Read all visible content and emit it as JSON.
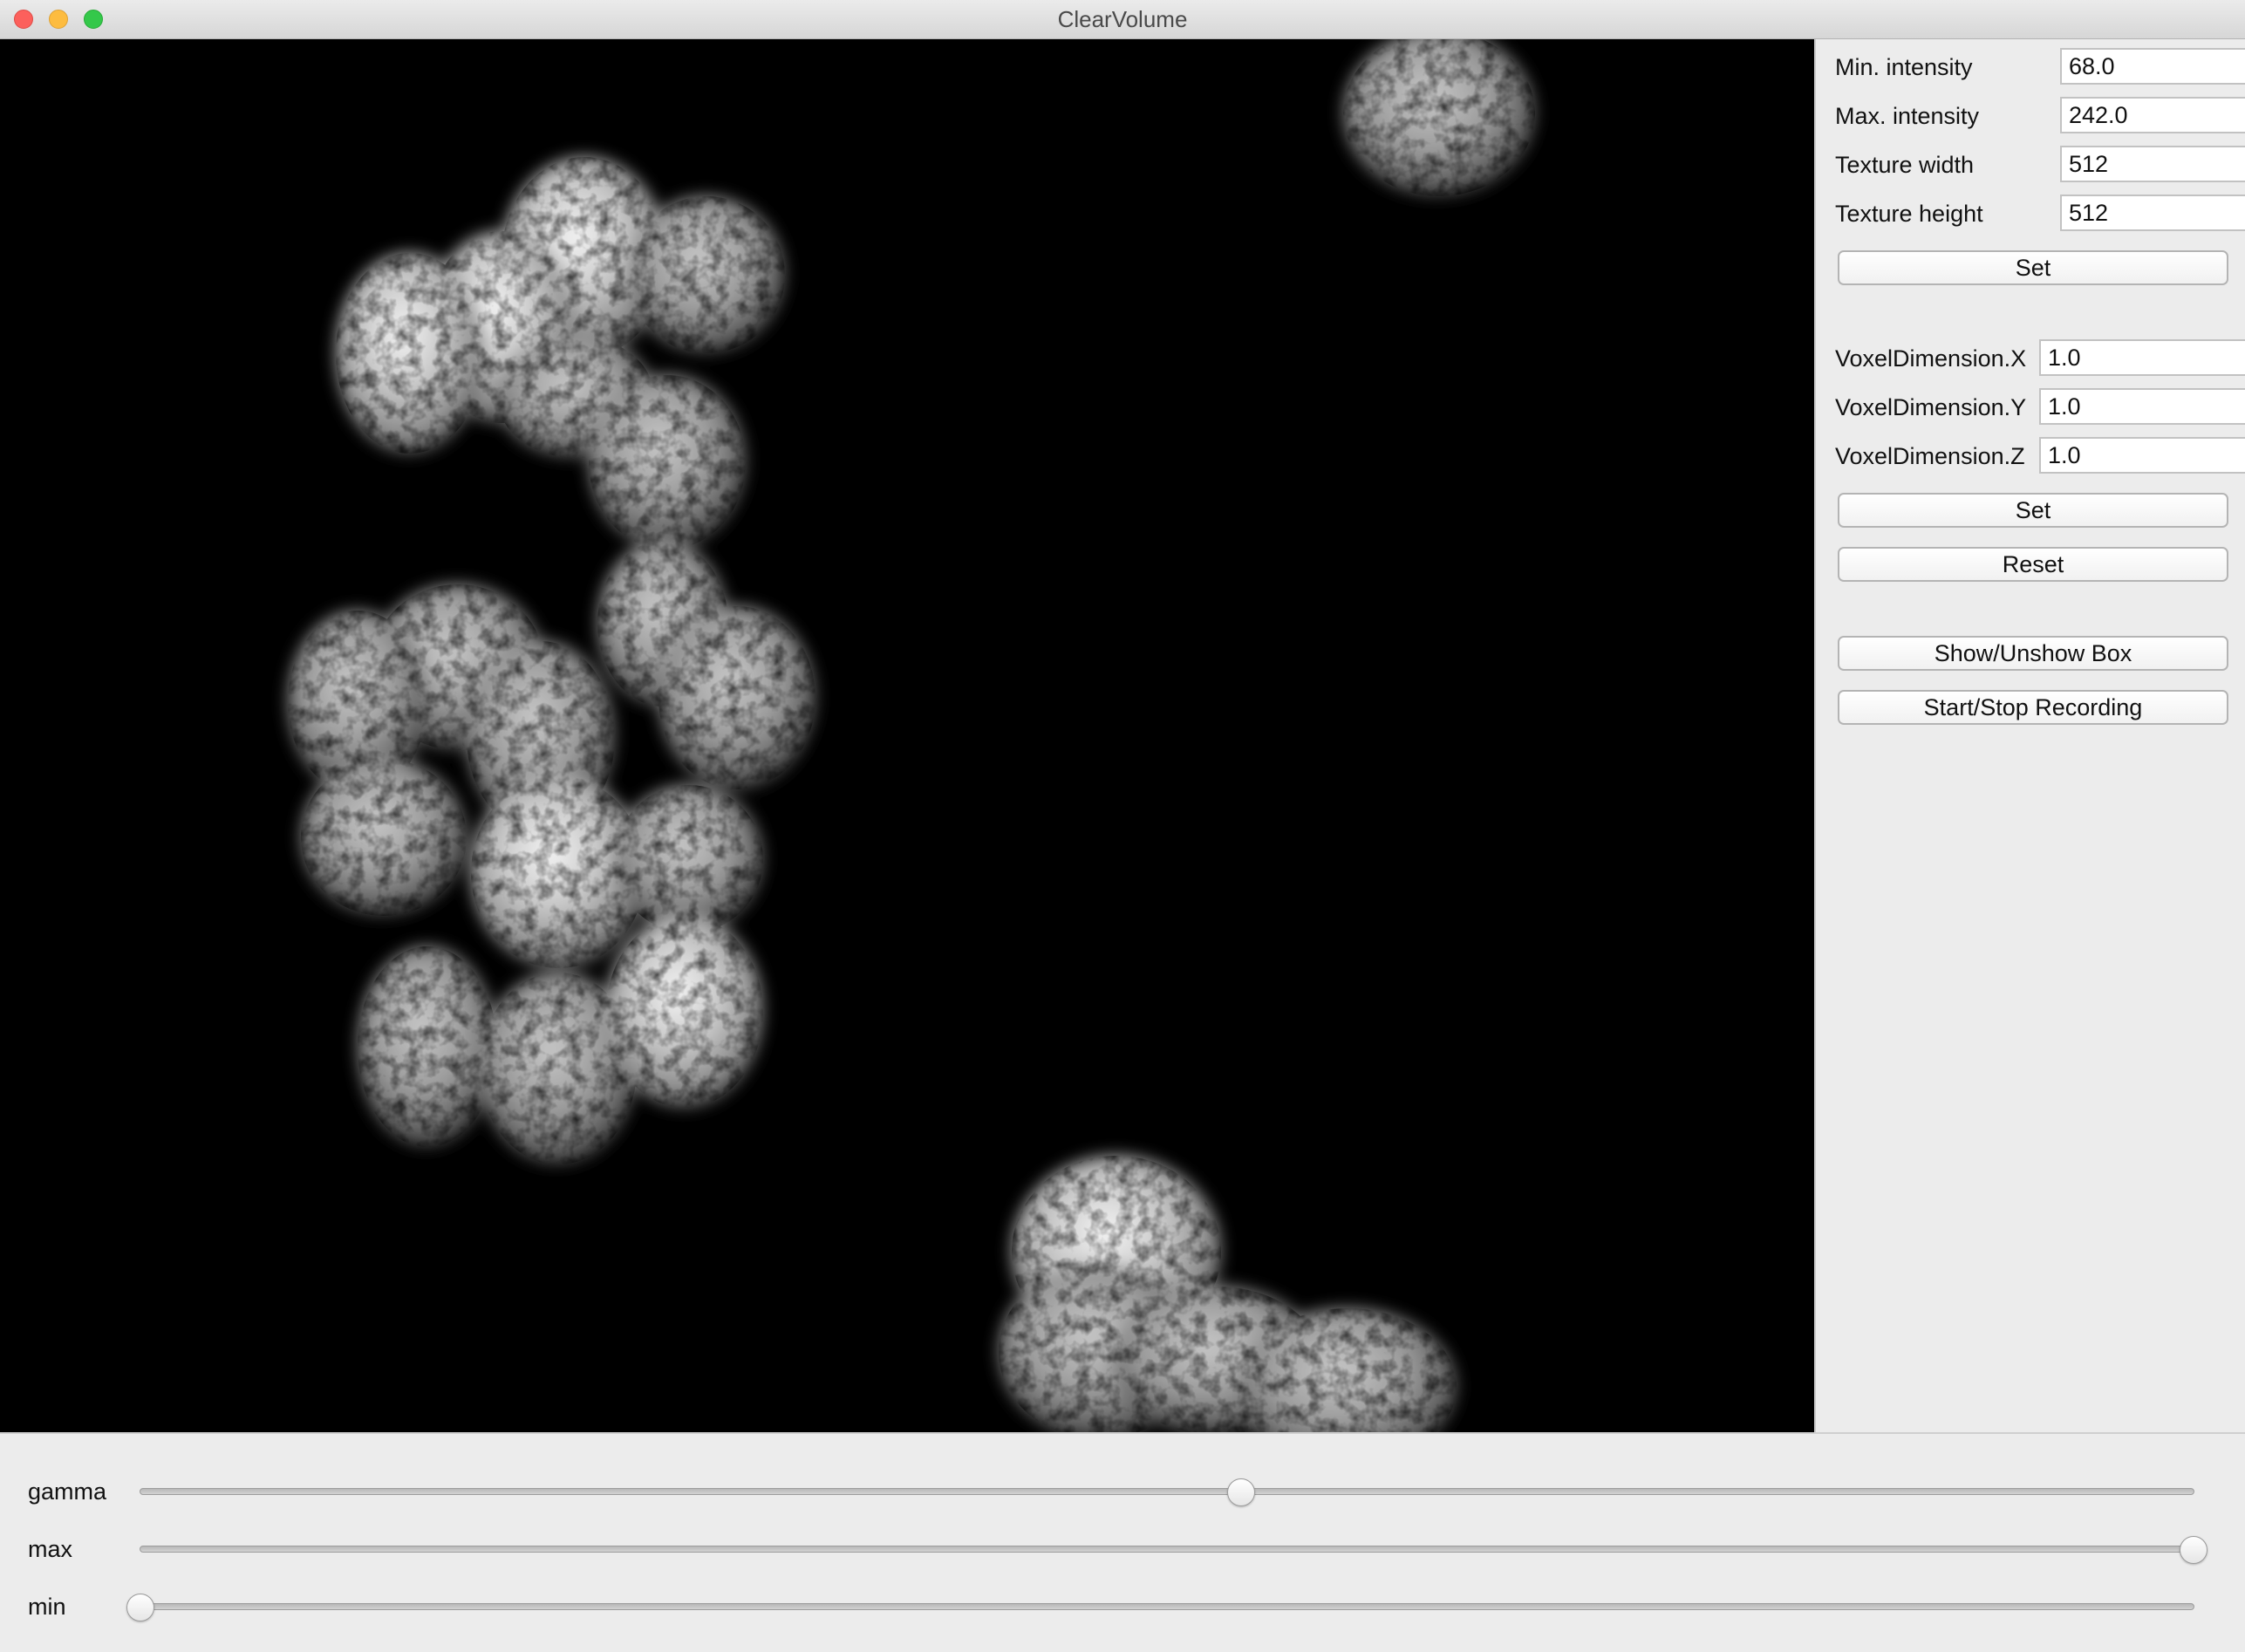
{
  "window": {
    "title": "ClearVolume",
    "controls": [
      "close-icon",
      "minimize-icon",
      "zoom-icon"
    ]
  },
  "viewport": {
    "content": "volume-render",
    "background": "#000000"
  },
  "panel": {
    "intensity": {
      "min_label": "Min. intensity",
      "min_value": "68.0",
      "max_label": "Max. intensity",
      "max_value": "242.0"
    },
    "texture": {
      "width_label": "Texture width",
      "width_value": "512",
      "height_label": "Texture height",
      "height_value": "512",
      "set_label": "Set"
    },
    "voxel": {
      "x_label": "VoxelDimension.X",
      "x_value": "1.0",
      "y_label": "VoxelDimension.Y",
      "y_value": "1.0",
      "z_label": "VoxelDimension.Z",
      "z_value": "1.0",
      "set_label": "Set",
      "reset_label": "Reset"
    },
    "show_box_label": "Show/Unshow Box",
    "recording_label": "Start/Stop Recording"
  },
  "sliders": [
    {
      "label": "gamma",
      "fraction": 0.536
    },
    {
      "label": "max",
      "fraction": 1.0
    },
    {
      "label": "min",
      "fraction": 0.0
    }
  ]
}
